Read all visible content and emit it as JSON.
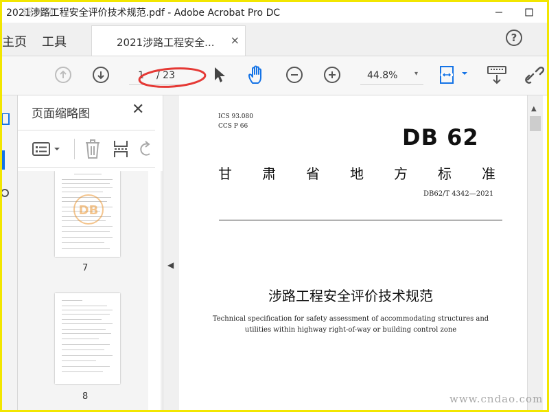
{
  "window": {
    "title": "2021涉路工程安全评价技术规范.pdf - Adobe Acrobat Pro DC",
    "watermark_top": "建材网"
  },
  "tabs": {
    "home_partial": "主页",
    "tools": "工具",
    "document_tab": "2021涉路工程安全...",
    "close_symbol": "×",
    "help_symbol": "?"
  },
  "toolbar": {
    "page_current": "1",
    "page_total": "/ 23",
    "zoom": "44.8%",
    "zoom_caret": "▾"
  },
  "thumbnail_panel": {
    "title": "页面缩略图",
    "close_symbol": "✕",
    "pages": [
      {
        "label": "7",
        "stamp": "DB"
      },
      {
        "label": "8"
      }
    ]
  },
  "document": {
    "ics": "ICS  93.080",
    "ccs": "CCS  P 66",
    "db_code": "DB 62",
    "standard_title_chars": [
      "甘",
      "肃",
      "省",
      "地",
      "方",
      "标",
      "准"
    ],
    "doc_number": "DB62/T 4342—2021",
    "title_cn": "涉路工程安全评价技术规范",
    "title_en_line1": "Technical specification for safety assessment of accommodating structures and",
    "title_en_line2": "utilities within highway right-of-way or building control zone"
  },
  "watermark_bottom": "www.cndao.com",
  "colors": {
    "frame": "#f2e600",
    "annotation_ellipse": "#e53935",
    "accent_blue": "#1473e6"
  }
}
